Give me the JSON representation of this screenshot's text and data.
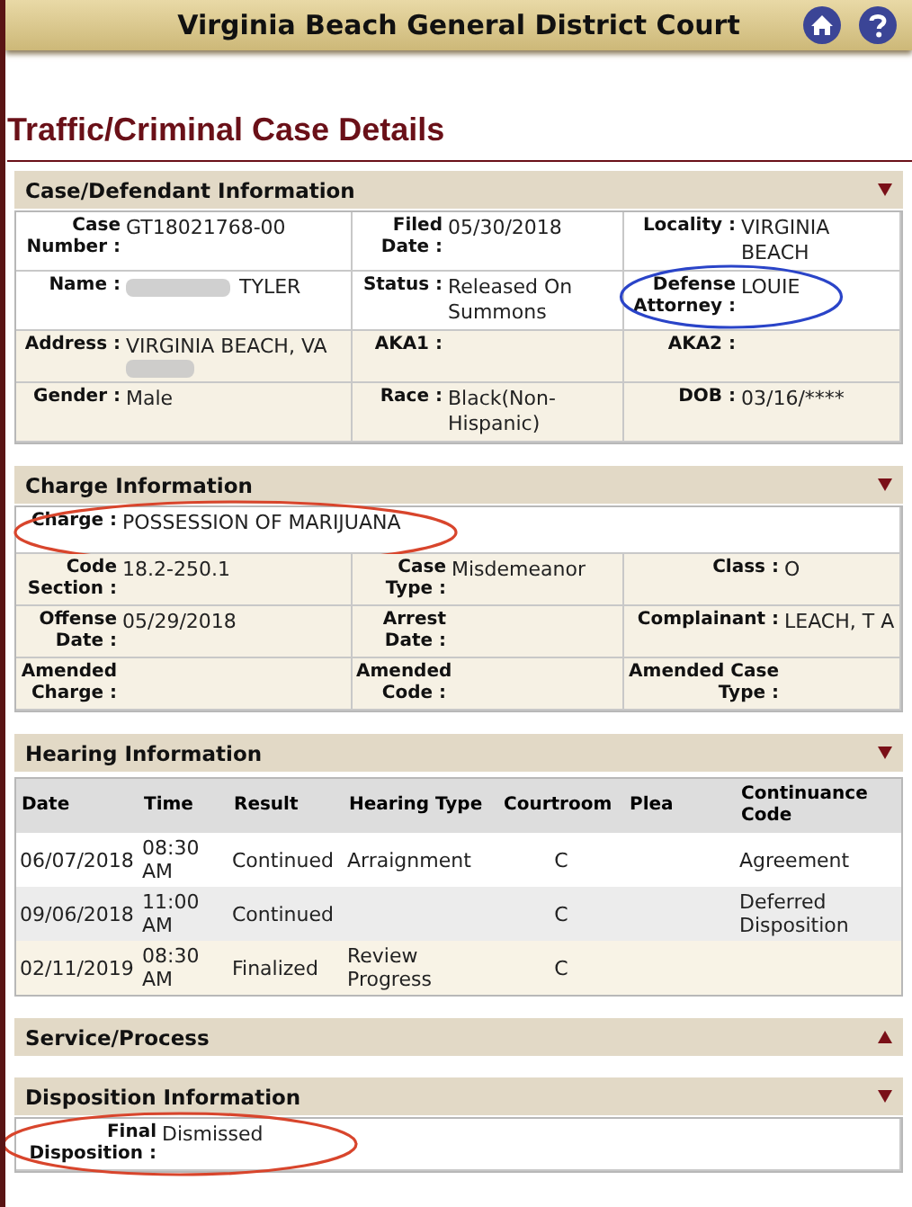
{
  "header": {
    "title": "Virginia Beach General District Court"
  },
  "page_title": "Traffic/Criminal Case Details",
  "sections": [
    {
      "title": "Case/Defendant Information",
      "expanded": true,
      "kind": "fields",
      "rows": [
        [
          {
            "label": "Case Number :",
            "value": "GT18021768-00"
          },
          {
            "label": "Filed Date :",
            "value": "05/30/2018"
          },
          {
            "label": "Locality :",
            "value": "VIRGINIA BEACH"
          }
        ],
        [
          {
            "label": "Name :",
            "parts": [
              {
                "kind": "redacted"
              },
              {
                "kind": "text",
                "text": "TYLER"
              }
            ]
          },
          {
            "label": "Status :",
            "value": "Released On Summons"
          },
          {
            "label": "Defense Attorney :",
            "value": "LOUIE",
            "annotation": {
              "kind": "ellipse",
              "color": "#2a44c8"
            }
          }
        ],
        [
          {
            "label": "Address :",
            "parts": [
              {
                "kind": "text",
                "text": "VIRGINIA BEACH, VA"
              },
              {
                "kind": "redacted"
              }
            ]
          },
          {
            "label": "AKA1 :"
          },
          {
            "label": "AKA2 :"
          }
        ],
        [
          {
            "label": "Gender :",
            "value": "Male"
          },
          {
            "label": "Race :",
            "value": "Black(Non-Hispanic)"
          },
          {
            "label": "DOB :",
            "value": "03/16/****"
          }
        ]
      ]
    },
    {
      "title": "Charge Information",
      "expanded": true,
      "kind": "fields",
      "rows": [
        [
          {
            "label": "Charge :",
            "value": "POSSESSION OF MARIJUANA",
            "annotation": {
              "kind": "ellipse",
              "color": "#d8452c"
            }
          }
        ],
        [
          {
            "label": "Code Section :",
            "value": "18.2-250.1"
          },
          {
            "label": "Case Type :",
            "value": "Misdemeanor"
          },
          {
            "label": "Class :",
            "value": "O"
          }
        ],
        [
          {
            "label": "Offense Date :",
            "value": "05/29/2018"
          },
          {
            "label": "Arrest Date :"
          },
          {
            "label": "Complainant :",
            "value": "LEACH, T A"
          }
        ],
        [
          {
            "label": "Amended Charge :"
          },
          {
            "label": "Amended Code :"
          },
          {
            "label": "Amended Case Type :"
          }
        ]
      ]
    },
    {
      "title": "Hearing Information",
      "expanded": true,
      "kind": "table",
      "columns": [
        "Date",
        "Time",
        "Result",
        "Hearing Type",
        "Courtroom",
        "Plea",
        "Continuance Code"
      ],
      "rows": [
        [
          "06/07/2018",
          "08:30 AM",
          "Continued",
          "Arraignment",
          "C",
          "",
          "Agreement"
        ],
        [
          "09/06/2018",
          "11:00 AM",
          "Continued",
          "",
          "C",
          "",
          "Deferred Disposition"
        ],
        [
          "02/11/2019",
          "08:30 AM",
          "Finalized",
          "Review Progress",
          "C",
          "",
          ""
        ]
      ]
    },
    {
      "title": "Service/Process",
      "expanded": false,
      "kind": "fields"
    },
    {
      "title": "Disposition Information",
      "expanded": true,
      "kind": "wide_fields",
      "rows": [
        [
          {
            "label": "Final Disposition :",
            "value": "Dismissed",
            "annotation": {
              "kind": "ellipse",
              "color": "#d8452c"
            }
          }
        ]
      ]
    }
  ]
}
